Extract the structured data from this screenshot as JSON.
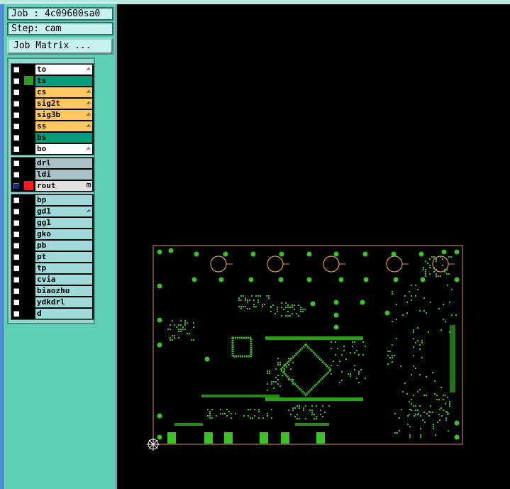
{
  "job": {
    "label": "Job : 4c09600sa0"
  },
  "step": {
    "label": "Step: cam"
  },
  "job_matrix_button": "Job Matrix ...",
  "layer_groups": [
    [
      {
        "name": "to",
        "color": "#ffffff",
        "pen": true,
        "swatch": "#000000"
      },
      {
        "name": "ts",
        "color": "#069c7a",
        "pen": false,
        "swatch": "#2f9c2a"
      },
      {
        "name": "cs",
        "color": "#ffc861",
        "pen": true,
        "swatch": "#000000"
      },
      {
        "name": "sig2t",
        "color": "#ffc861",
        "pen": true,
        "swatch": "#000000"
      },
      {
        "name": "sig3b",
        "color": "#ffc861",
        "pen": true,
        "swatch": "#000000"
      },
      {
        "name": "ss",
        "color": "#ffc861",
        "pen": true,
        "swatch": "#000000"
      },
      {
        "name": "bs",
        "color": "#069c7a",
        "pen": false,
        "swatch": "#000000"
      },
      {
        "name": "bo",
        "color": "#ffffff",
        "pen": true,
        "swatch": "#000000"
      }
    ],
    [
      {
        "name": "drl",
        "color": "#a8c3c8",
        "pen": false,
        "swatch": "#000000"
      },
      {
        "name": "ldi",
        "color": "#a8c3c8",
        "pen": false,
        "swatch": "#000000"
      },
      {
        "name": "rout",
        "color": "#e0e0e0",
        "pen": false,
        "swatch": "#ff1a1a",
        "checked": true,
        "mark": "⊞"
      }
    ],
    [
      {
        "name": "bp",
        "color": "#9fd9d9",
        "pen": false,
        "swatch": "#000000"
      },
      {
        "name": "gd1",
        "color": "#9fd9d9",
        "pen": true,
        "swatch": "#000000"
      },
      {
        "name": "gg1",
        "color": "#9fd9d9",
        "pen": false,
        "swatch": "#000000"
      },
      {
        "name": "gko",
        "color": "#9fd9d9",
        "pen": false,
        "swatch": "#000000"
      },
      {
        "name": "pb",
        "color": "#9fd9d9",
        "pen": false,
        "swatch": "#000000"
      },
      {
        "name": "pt",
        "color": "#9fd9d9",
        "pen": false,
        "swatch": "#000000"
      },
      {
        "name": "tp",
        "color": "#9fd9d9",
        "pen": false,
        "swatch": "#000000"
      },
      {
        "name": "cvia",
        "color": "#9fd9d9",
        "pen": false,
        "swatch": "#000000"
      },
      {
        "name": "biaozhu",
        "color": "#9fd9d9",
        "pen": false,
        "swatch": "#000000"
      },
      {
        "name": "ydkdrl",
        "color": "#9fd9d9",
        "pen": false,
        "swatch": "#000000"
      },
      {
        "name": "d",
        "color": "#9fd9d9",
        "pen": false,
        "swatch": "#000000"
      }
    ]
  ],
  "colors": {
    "pcb_outline": "#d49a5a",
    "pcb_pad": "#3fbf2a",
    "background": "#000000"
  },
  "icons": {
    "pen": "pencil-icon",
    "origin": "origin-crosshair-icon"
  }
}
